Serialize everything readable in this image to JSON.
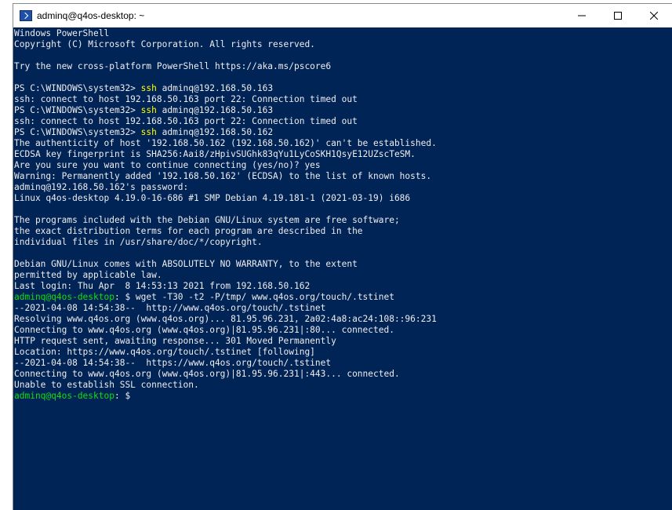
{
  "window": {
    "title": "adminq@q4os-desktop: ~"
  },
  "console": {
    "lines": [
      [
        {
          "t": "Windows PowerShell",
          "c": "white"
        }
      ],
      [
        {
          "t": "Copyright (C) Microsoft Corporation. All rights reserved.",
          "c": "white"
        }
      ],
      [
        {
          "t": "",
          "c": "white"
        }
      ],
      [
        {
          "t": "Try the new cross-platform PowerShell https://aka.ms/pscore6",
          "c": "white"
        }
      ],
      [
        {
          "t": "",
          "c": "white"
        }
      ],
      [
        {
          "t": "PS C:\\WINDOWS\\system32> ",
          "c": "white"
        },
        {
          "t": "ssh",
          "c": "yellow"
        },
        {
          "t": " adminq@192.168.50.163",
          "c": "white"
        }
      ],
      [
        {
          "t": "ssh: connect to host 192.168.50.163 port 22: Connection timed out",
          "c": "white"
        }
      ],
      [
        {
          "t": "PS C:\\WINDOWS\\system32> ",
          "c": "white"
        },
        {
          "t": "ssh",
          "c": "yellow"
        },
        {
          "t": " adminq@192.168.50.163",
          "c": "white"
        }
      ],
      [
        {
          "t": "ssh: connect to host 192.168.50.163 port 22: Connection timed out",
          "c": "white"
        }
      ],
      [
        {
          "t": "PS C:\\WINDOWS\\system32> ",
          "c": "white"
        },
        {
          "t": "ssh",
          "c": "yellow"
        },
        {
          "t": " adminq@192.168.50.162",
          "c": "white"
        }
      ],
      [
        {
          "t": "The authenticity of host '192.168.50.162 (192.168.50.162)' can't be established.",
          "c": "white"
        }
      ],
      [
        {
          "t": "ECDSA key fingerprint is SHA256:Aai8/zHpivSUGhk83qYu1LyCoSKH1QsyE12UZscTeSM.",
          "c": "white"
        }
      ],
      [
        {
          "t": "Are you sure you want to continue connecting (yes/no)? yes",
          "c": "white"
        }
      ],
      [
        {
          "t": "Warning: Permanently added '192.168.50.162' (ECDSA) to the list of known hosts.",
          "c": "white"
        }
      ],
      [
        {
          "t": "adminq@192.168.50.162's password:",
          "c": "white"
        }
      ],
      [
        {
          "t": "Linux q4os-desktop 4.19.0-16-686 #1 SMP Debian 4.19.181-1 (2021-03-19) i686",
          "c": "white"
        }
      ],
      [
        {
          "t": "",
          "c": "white"
        }
      ],
      [
        {
          "t": "The programs included with the Debian GNU/Linux system are free software;",
          "c": "white"
        }
      ],
      [
        {
          "t": "the exact distribution terms for each program are described in the",
          "c": "white"
        }
      ],
      [
        {
          "t": "individual files in /usr/share/doc/*/copyright.",
          "c": "white"
        }
      ],
      [
        {
          "t": "",
          "c": "white"
        }
      ],
      [
        {
          "t": "Debian GNU/Linux comes with ABSOLUTELY NO WARRANTY, to the extent",
          "c": "white"
        }
      ],
      [
        {
          "t": "permitted by applicable law.",
          "c": "white"
        }
      ],
      [
        {
          "t": "Last login: Thu Apr  8 14:53:13 2021 from 192.168.50.162",
          "c": "white"
        }
      ],
      [
        {
          "t": "adminq@q4os-desktop",
          "c": "green"
        },
        {
          "t": ": $ wget -T30 -t2 -P/tmp/ www.q4os.org/touch/.tstinet",
          "c": "white"
        }
      ],
      [
        {
          "t": "--2021-04-08 14:54:38--  http://www.q4os.org/touch/.tstinet",
          "c": "white"
        }
      ],
      [
        {
          "t": "Resolving www.q4os.org (www.q4os.org)... 81.95.96.231, 2a02:4a8:ac24:108::96:231",
          "c": "white"
        }
      ],
      [
        {
          "t": "Connecting to www.q4os.org (www.q4os.org)|81.95.96.231|:80... connected.",
          "c": "white"
        }
      ],
      [
        {
          "t": "HTTP request sent, awaiting response... 301 Moved Permanently",
          "c": "white"
        }
      ],
      [
        {
          "t": "Location: https://www.q4os.org/touch/.tstinet [following]",
          "c": "white"
        }
      ],
      [
        {
          "t": "--2021-04-08 14:54:38--  https://www.q4os.org/touch/.tstinet",
          "c": "white"
        }
      ],
      [
        {
          "t": "Connecting to www.q4os.org (www.q4os.org)|81.95.96.231|:443... connected.",
          "c": "white"
        }
      ],
      [
        {
          "t": "Unable to establish SSL connection.",
          "c": "white"
        }
      ],
      [
        {
          "t": "adminq@q4os-desktop",
          "c": "green"
        },
        {
          "t": ": $ ",
          "c": "white"
        }
      ]
    ]
  }
}
